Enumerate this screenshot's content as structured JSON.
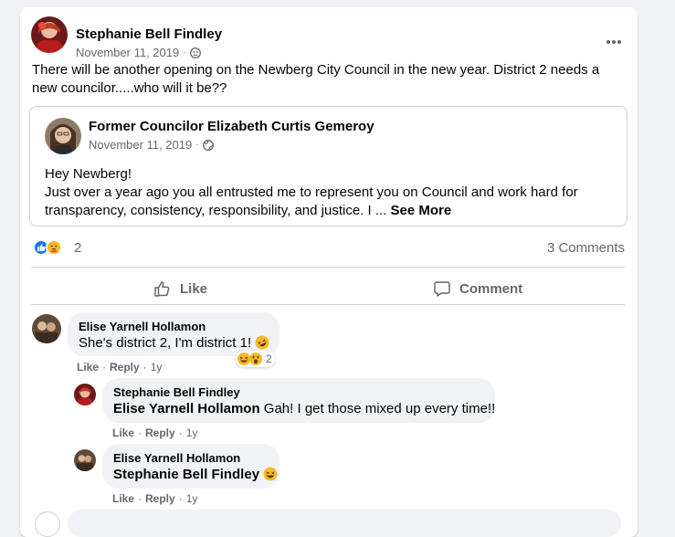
{
  "post": {
    "author": "Stephanie Bell Findley",
    "date": "November 11, 2019",
    "privacy_separator": "·",
    "privacy_icon": "friends-icon",
    "text": "There will be another opening on the Newberg City Council in the new year. District 2 needs a new councilor.....who will it be??"
  },
  "shared_post": {
    "author": "Former Councilor Elizabeth Curtis Gemeroy",
    "date": "November 11, 2019",
    "privacy_separator": "·",
    "privacy_icon": "globe-icon",
    "text_line1": "Hey Newberg!",
    "text_line2": "Just over a year ago you all entrusted me to represent you on Council and work hard for transparency, consistency, responsibility, and justice. I ...",
    "see_more": "See More"
  },
  "reactions": {
    "count": "2",
    "icons": [
      "like-icon",
      "care-icon"
    ],
    "comments": "3 Comments"
  },
  "actions": {
    "like": "Like",
    "comment": "Comment"
  },
  "comments": [
    {
      "author": "Elise Yarnell Hollamon",
      "text": "She's district 2, I'm district 1!",
      "emoji": "rofl-emoji",
      "reaction_count": "2",
      "like": "Like",
      "reply": "Reply",
      "age": "1y"
    },
    {
      "author": "Stephanie Bell Findley",
      "tag": "Elise Yarnell Hollamon",
      "text": "Gah! I get those mixed up every time!!",
      "like": "Like",
      "reply": "Reply",
      "age": "1y"
    },
    {
      "author": "Elise Yarnell Hollamon",
      "tag": "Stephanie Bell Findley",
      "emoji": "laughing-emoji",
      "like": "Like",
      "reply": "Reply",
      "age": "1y"
    }
  ],
  "colors": {
    "like_blue": "#1877f2",
    "secondary_text": "#65676b",
    "bubble_bg": "#f0f2f5",
    "emoji_yellow": "#f7b928"
  }
}
